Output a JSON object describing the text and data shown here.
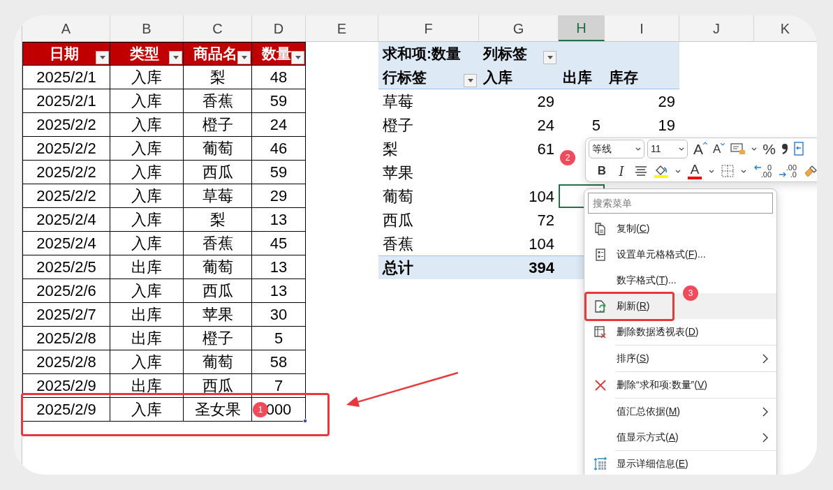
{
  "column_headers": [
    {
      "letter": "A",
      "selected": false
    },
    {
      "letter": "B",
      "selected": false
    },
    {
      "letter": "C",
      "selected": false
    },
    {
      "letter": "D",
      "selected": false
    },
    {
      "letter": "E",
      "selected": false
    },
    {
      "letter": "F",
      "selected": false
    },
    {
      "letter": "G",
      "selected": false
    },
    {
      "letter": "H",
      "selected": true
    },
    {
      "letter": "I",
      "selected": false
    },
    {
      "letter": "J",
      "selected": false
    },
    {
      "letter": "K",
      "selected": false
    }
  ],
  "table": {
    "headers": [
      "日期",
      "类型",
      "商品名",
      "数量"
    ],
    "rows": [
      [
        "2025/2/1",
        "入库",
        "梨",
        "48"
      ],
      [
        "2025/2/1",
        "入库",
        "香蕉",
        "59"
      ],
      [
        "2025/2/2",
        "入库",
        "橙子",
        "24"
      ],
      [
        "2025/2/2",
        "入库",
        "葡萄",
        "46"
      ],
      [
        "2025/2/2",
        "入库",
        "西瓜",
        "59"
      ],
      [
        "2025/2/2",
        "入库",
        "草莓",
        "29"
      ],
      [
        "2025/2/4",
        "入库",
        "梨",
        "13"
      ],
      [
        "2025/2/4",
        "入库",
        "香蕉",
        "45"
      ],
      [
        "2025/2/5",
        "出库",
        "葡萄",
        "13"
      ],
      [
        "2025/2/6",
        "入库",
        "西瓜",
        "13"
      ],
      [
        "2025/2/7",
        "出库",
        "苹果",
        "30"
      ],
      [
        "2025/2/8",
        "出库",
        "橙子",
        "5"
      ],
      [
        "2025/2/8",
        "入库",
        "葡萄",
        "58"
      ],
      [
        "2025/2/9",
        "出库",
        "西瓜",
        "7"
      ],
      [
        "2025/2/9",
        "入库",
        "圣女果",
        "000"
      ]
    ]
  },
  "pivot": {
    "value_field": "求和项:数量",
    "column_labels": "列标签",
    "row_labels": "行标签",
    "columns": [
      "入库",
      "出库",
      "库存"
    ],
    "rows": [
      {
        "label": "草莓",
        "in": "29",
        "stock": "29",
        "selected": false
      },
      {
        "label": "橙子",
        "in": "24",
        "out": "5",
        "stock": "19",
        "selected": false
      },
      {
        "label": "梨",
        "in": "61",
        "selected": false
      },
      {
        "label": "苹果",
        "selected": false
      },
      {
        "label": "葡萄",
        "in": "104",
        "selected": true
      },
      {
        "label": "西瓜",
        "in": "72",
        "selected": false
      },
      {
        "label": "香蕉",
        "in": "104",
        "selected": false
      }
    ],
    "total": {
      "label": "总计",
      "in": "394"
    }
  },
  "mini_toolbar": {
    "font": "等线",
    "size": "11",
    "tools_top": [
      {
        "kind": "grow",
        "text": "A"
      },
      {
        "kind": "shrink",
        "text": "A"
      },
      {
        "kind": "cell-styles"
      },
      {
        "kind": "percent",
        "text": "%"
      },
      {
        "kind": "comma"
      },
      {
        "kind": "wrap"
      }
    ],
    "tools_bottom": [
      {
        "kind": "bold",
        "text": "B"
      },
      {
        "kind": "italic",
        "text": "I"
      },
      {
        "kind": "align"
      },
      {
        "kind": "fill",
        "color": "#ffff00"
      },
      {
        "kind": "font-color",
        "text": "A",
        "color": "#ff0000"
      },
      {
        "kind": "borders"
      },
      {
        "kind": "inc-decimal",
        "text": [
          "0",
          ".00"
        ]
      },
      {
        "kind": "dec-decimal",
        "text": [
          ".00",
          ".0"
        ]
      },
      {
        "kind": "painter"
      }
    ]
  },
  "context_menu": {
    "search_placeholder": "搜索菜单",
    "items": [
      {
        "kind": "copy",
        "text": [
          "复制(",
          "C",
          ")"
        ],
        "highlighted": false,
        "submenu": false
      },
      {
        "kind": "format",
        "text": [
          "设置单元格格式(",
          "F",
          ")..."
        ],
        "highlighted": false,
        "submenu": false
      },
      {
        "kind": "plain",
        "text": [
          "数字格式(",
          "T",
          ")..."
        ],
        "highlighted": false,
        "submenu": false
      },
      {
        "kind": "refresh",
        "text": [
          "刷新(",
          "R",
          ")"
        ],
        "highlighted": true,
        "submenu": false
      },
      {
        "kind": "delete-pivot",
        "text": [
          "删除数据透视表(",
          "D",
          ")"
        ],
        "highlighted": false,
        "submenu": false
      },
      {
        "kind": "separator"
      },
      {
        "kind": "plain",
        "text": [
          "排序(",
          "S",
          ")"
        ],
        "highlighted": false,
        "submenu": true
      },
      {
        "kind": "separator"
      },
      {
        "kind": "remove",
        "text": [
          "删除“求和项:数量”(",
          "V",
          ")"
        ],
        "highlighted": false,
        "submenu": false
      },
      {
        "kind": "separator"
      },
      {
        "kind": "plain",
        "text": [
          "值汇总依据(",
          "M",
          ")"
        ],
        "highlighted": false,
        "submenu": true
      },
      {
        "kind": "plain",
        "text": [
          "值显示方式(",
          "A",
          ")"
        ],
        "highlighted": false,
        "submenu": true
      },
      {
        "kind": "separator"
      },
      {
        "kind": "details",
        "text": [
          "显示详细信息(",
          "E",
          ")"
        ],
        "highlighted": false,
        "submenu": false
      }
    ]
  },
  "annotations": {
    "badges": [
      "1",
      "2",
      "3"
    ]
  }
}
